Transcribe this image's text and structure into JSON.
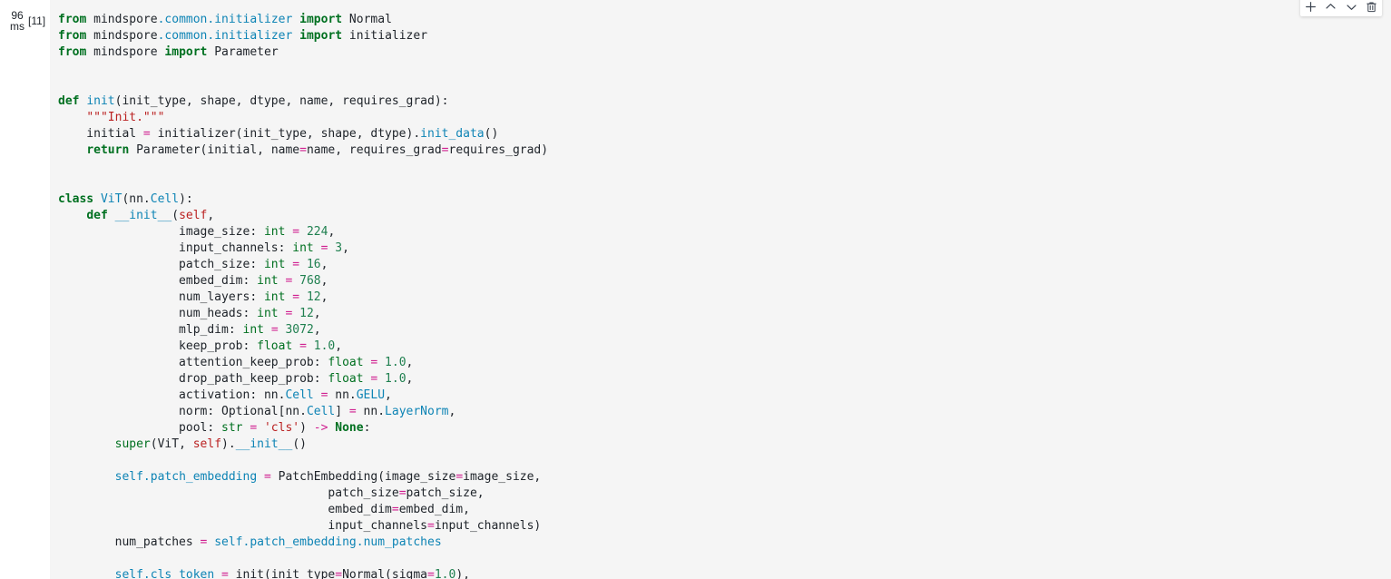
{
  "cell": {
    "execution_timer": {
      "value": "96",
      "unit": "ms"
    },
    "execution_count": "[11]",
    "language": "python",
    "background_color": "#f5f5f5",
    "code_lines": [
      [
        {
          "t": "from ",
          "c": "kw"
        },
        {
          "t": "mindspore",
          "c": "pl"
        },
        {
          "t": ".common",
          "c": "nm"
        },
        {
          "t": ".initializer",
          "c": "nm"
        },
        {
          "t": " ",
          "c": "pl"
        },
        {
          "t": "import",
          "c": "kw"
        },
        {
          "t": " Normal",
          "c": "pl"
        }
      ],
      [
        {
          "t": "from ",
          "c": "kw"
        },
        {
          "t": "mindspore",
          "c": "pl"
        },
        {
          "t": ".common",
          "c": "nm"
        },
        {
          "t": ".initializer",
          "c": "nm"
        },
        {
          "t": " ",
          "c": "pl"
        },
        {
          "t": "import",
          "c": "kw"
        },
        {
          "t": " initializer",
          "c": "pl"
        }
      ],
      [
        {
          "t": "from ",
          "c": "kw"
        },
        {
          "t": "mindspore ",
          "c": "pl"
        },
        {
          "t": "import",
          "c": "kw"
        },
        {
          "t": " Parameter",
          "c": "pl"
        }
      ],
      [],
      [],
      [
        {
          "t": "def ",
          "c": "kw"
        },
        {
          "t": "init",
          "c": "nm"
        },
        {
          "t": "(init_type, shape, dtype, name, requires_grad):",
          "c": "pl"
        }
      ],
      [
        {
          "t": "    ",
          "c": "pl"
        },
        {
          "t": "\"\"\"Init.\"\"\"",
          "c": "str"
        }
      ],
      [
        {
          "t": "    initial ",
          "c": "pl"
        },
        {
          "t": "=",
          "c": "op"
        },
        {
          "t": " initializer(init_type, shape, dtype).",
          "c": "pl"
        },
        {
          "t": "init_data",
          "c": "nm"
        },
        {
          "t": "()",
          "c": "pl"
        }
      ],
      [
        {
          "t": "    ",
          "c": "pl"
        },
        {
          "t": "return",
          "c": "kw"
        },
        {
          "t": " Parameter(initial, name",
          "c": "pl"
        },
        {
          "t": "=",
          "c": "op"
        },
        {
          "t": "name, requires_grad",
          "c": "pl"
        },
        {
          "t": "=",
          "c": "op"
        },
        {
          "t": "requires_grad)",
          "c": "pl"
        }
      ],
      [],
      [],
      [
        {
          "t": "class ",
          "c": "kw"
        },
        {
          "t": "ViT",
          "c": "nm"
        },
        {
          "t": "(nn.",
          "c": "pl"
        },
        {
          "t": "Cell",
          "c": "nm"
        },
        {
          "t": "):",
          "c": "pl"
        }
      ],
      [
        {
          "t": "    ",
          "c": "pl"
        },
        {
          "t": "def ",
          "c": "kw"
        },
        {
          "t": "__init__",
          "c": "nm"
        },
        {
          "t": "(",
          "c": "pl"
        },
        {
          "t": "self",
          "c": "slf"
        },
        {
          "t": ",",
          "c": "pl"
        }
      ],
      [
        {
          "t": "                 image_size: ",
          "c": "pl"
        },
        {
          "t": "int",
          "c": "bi"
        },
        {
          "t": " ",
          "c": "pl"
        },
        {
          "t": "=",
          "c": "op"
        },
        {
          "t": " ",
          "c": "pl"
        },
        {
          "t": "224",
          "c": "num"
        },
        {
          "t": ",",
          "c": "pl"
        }
      ],
      [
        {
          "t": "                 input_channels: ",
          "c": "pl"
        },
        {
          "t": "int",
          "c": "bi"
        },
        {
          "t": " ",
          "c": "pl"
        },
        {
          "t": "=",
          "c": "op"
        },
        {
          "t": " ",
          "c": "pl"
        },
        {
          "t": "3",
          "c": "num"
        },
        {
          "t": ",",
          "c": "pl"
        }
      ],
      [
        {
          "t": "                 patch_size: ",
          "c": "pl"
        },
        {
          "t": "int",
          "c": "bi"
        },
        {
          "t": " ",
          "c": "pl"
        },
        {
          "t": "=",
          "c": "op"
        },
        {
          "t": " ",
          "c": "pl"
        },
        {
          "t": "16",
          "c": "num"
        },
        {
          "t": ",",
          "c": "pl"
        }
      ],
      [
        {
          "t": "                 embed_dim: ",
          "c": "pl"
        },
        {
          "t": "int",
          "c": "bi"
        },
        {
          "t": " ",
          "c": "pl"
        },
        {
          "t": "=",
          "c": "op"
        },
        {
          "t": " ",
          "c": "pl"
        },
        {
          "t": "768",
          "c": "num"
        },
        {
          "t": ",",
          "c": "pl"
        }
      ],
      [
        {
          "t": "                 num_layers: ",
          "c": "pl"
        },
        {
          "t": "int",
          "c": "bi"
        },
        {
          "t": " ",
          "c": "pl"
        },
        {
          "t": "=",
          "c": "op"
        },
        {
          "t": " ",
          "c": "pl"
        },
        {
          "t": "12",
          "c": "num"
        },
        {
          "t": ",",
          "c": "pl"
        }
      ],
      [
        {
          "t": "                 num_heads: ",
          "c": "pl"
        },
        {
          "t": "int",
          "c": "bi"
        },
        {
          "t": " ",
          "c": "pl"
        },
        {
          "t": "=",
          "c": "op"
        },
        {
          "t": " ",
          "c": "pl"
        },
        {
          "t": "12",
          "c": "num"
        },
        {
          "t": ",",
          "c": "pl"
        }
      ],
      [
        {
          "t": "                 mlp_dim: ",
          "c": "pl"
        },
        {
          "t": "int",
          "c": "bi"
        },
        {
          "t": " ",
          "c": "pl"
        },
        {
          "t": "=",
          "c": "op"
        },
        {
          "t": " ",
          "c": "pl"
        },
        {
          "t": "3072",
          "c": "num"
        },
        {
          "t": ",",
          "c": "pl"
        }
      ],
      [
        {
          "t": "                 keep_prob: ",
          "c": "pl"
        },
        {
          "t": "float",
          "c": "bi"
        },
        {
          "t": " ",
          "c": "pl"
        },
        {
          "t": "=",
          "c": "op"
        },
        {
          "t": " ",
          "c": "pl"
        },
        {
          "t": "1.0",
          "c": "num"
        },
        {
          "t": ",",
          "c": "pl"
        }
      ],
      [
        {
          "t": "                 attention_keep_prob: ",
          "c": "pl"
        },
        {
          "t": "float",
          "c": "bi"
        },
        {
          "t": " ",
          "c": "pl"
        },
        {
          "t": "=",
          "c": "op"
        },
        {
          "t": " ",
          "c": "pl"
        },
        {
          "t": "1.0",
          "c": "num"
        },
        {
          "t": ",",
          "c": "pl"
        }
      ],
      [
        {
          "t": "                 drop_path_keep_prob: ",
          "c": "pl"
        },
        {
          "t": "float",
          "c": "bi"
        },
        {
          "t": " ",
          "c": "pl"
        },
        {
          "t": "=",
          "c": "op"
        },
        {
          "t": " ",
          "c": "pl"
        },
        {
          "t": "1.0",
          "c": "num"
        },
        {
          "t": ",",
          "c": "pl"
        }
      ],
      [
        {
          "t": "                 activation: nn.",
          "c": "pl"
        },
        {
          "t": "Cell",
          "c": "nm"
        },
        {
          "t": " ",
          "c": "pl"
        },
        {
          "t": "=",
          "c": "op"
        },
        {
          "t": " nn.",
          "c": "pl"
        },
        {
          "t": "GELU",
          "c": "nm"
        },
        {
          "t": ",",
          "c": "pl"
        }
      ],
      [
        {
          "t": "                 norm: Optional[nn.",
          "c": "pl"
        },
        {
          "t": "Cell",
          "c": "nm"
        },
        {
          "t": "] ",
          "c": "pl"
        },
        {
          "t": "=",
          "c": "op"
        },
        {
          "t": " nn.",
          "c": "pl"
        },
        {
          "t": "LayerNorm",
          "c": "nm"
        },
        {
          "t": ",",
          "c": "pl"
        }
      ],
      [
        {
          "t": "                 pool: ",
          "c": "pl"
        },
        {
          "t": "str",
          "c": "bi"
        },
        {
          "t": " ",
          "c": "pl"
        },
        {
          "t": "=",
          "c": "op"
        },
        {
          "t": " ",
          "c": "pl"
        },
        {
          "t": "'cls'",
          "c": "str"
        },
        {
          "t": ") ",
          "c": "pl"
        },
        {
          "t": "->",
          "c": "op"
        },
        {
          "t": " ",
          "c": "pl"
        },
        {
          "t": "None",
          "c": "kw"
        },
        {
          "t": ":",
          "c": "pl"
        }
      ],
      [
        {
          "t": "        ",
          "c": "pl"
        },
        {
          "t": "super",
          "c": "bi"
        },
        {
          "t": "(ViT, ",
          "c": "pl"
        },
        {
          "t": "self",
          "c": "slf"
        },
        {
          "t": ").",
          "c": "pl"
        },
        {
          "t": "__init__",
          "c": "nm"
        },
        {
          "t": "()",
          "c": "pl"
        }
      ],
      [],
      [
        {
          "t": "        ",
          "c": "pl"
        },
        {
          "t": "self.patch_embedding",
          "c": "nm"
        },
        {
          "t": " ",
          "c": "pl"
        },
        {
          "t": "=",
          "c": "op"
        },
        {
          "t": " PatchEmbedding(image_size",
          "c": "pl"
        },
        {
          "t": "=",
          "c": "op"
        },
        {
          "t": "image_size,",
          "c": "pl"
        }
      ],
      [
        {
          "t": "                                      patch_size",
          "c": "pl"
        },
        {
          "t": "=",
          "c": "op"
        },
        {
          "t": "patch_size,",
          "c": "pl"
        }
      ],
      [
        {
          "t": "                                      embed_dim",
          "c": "pl"
        },
        {
          "t": "=",
          "c": "op"
        },
        {
          "t": "embed_dim,",
          "c": "pl"
        }
      ],
      [
        {
          "t": "                                      input_channels",
          "c": "pl"
        },
        {
          "t": "=",
          "c": "op"
        },
        {
          "t": "input_channels)",
          "c": "pl"
        }
      ],
      [
        {
          "t": "        num_patches ",
          "c": "pl"
        },
        {
          "t": "=",
          "c": "op"
        },
        {
          "t": " ",
          "c": "pl"
        },
        {
          "t": "self.patch_embedding.num_patches",
          "c": "nm"
        }
      ],
      [],
      [
        {
          "t": "        ",
          "c": "pl"
        },
        {
          "t": "self.cls_token",
          "c": "nm"
        },
        {
          "t": " ",
          "c": "pl"
        },
        {
          "t": "=",
          "c": "op"
        },
        {
          "t": " init(init_type",
          "c": "pl"
        },
        {
          "t": "=",
          "c": "op"
        },
        {
          "t": "Normal(sigma",
          "c": "pl"
        },
        {
          "t": "=",
          "c": "op"
        },
        {
          "t": "1.0",
          "c": "num"
        },
        {
          "t": "),",
          "c": "pl"
        }
      ]
    ]
  },
  "toolbar": {
    "buttons": [
      {
        "name": "add-cell-button",
        "icon": "plus-icon",
        "label": "Insert cell below"
      },
      {
        "name": "move-cell-up-button",
        "icon": "chevron-up-icon",
        "label": "Move cell up"
      },
      {
        "name": "move-cell-down-button",
        "icon": "chevron-down-icon",
        "label": "Move cell down"
      },
      {
        "name": "delete-cell-button",
        "icon": "trash-icon",
        "label": "Delete cell"
      }
    ]
  },
  "colors": {
    "cell_background": "#f5f5f5",
    "page_background": "#ffffff",
    "keyword": "#007020",
    "builtin": "#007020",
    "name": "#0e84b5",
    "number": "#208050",
    "operator": "#d02090",
    "string": "#ba2121",
    "plain": "#20252b"
  }
}
